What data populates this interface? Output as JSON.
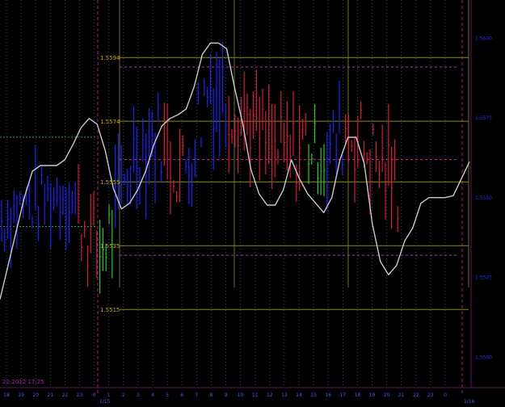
{
  "chart_data": {
    "type": "bar",
    "title": "",
    "timestamp_label": "22-2012 17:25",
    "level_labels": [
      "1.5594",
      "1.5574",
      "1.5555",
      "1.5535",
      "1.5515"
    ],
    "level_values": [
      1.5594,
      1.5574,
      1.5555,
      1.5535,
      1.5515
    ],
    "magenta_levels": [
      1.5591,
      1.5562,
      1.5532
    ],
    "right_axis_labels": [
      "1.5600",
      "1.5575",
      "1.5550",
      "1.5525",
      "1.5500"
    ],
    "right_axis_values": [
      1.56,
      1.5575,
      1.555,
      1.5525,
      1.55
    ],
    "x_tick_labels": [
      "18",
      "19",
      "20",
      "21",
      "22",
      "23",
      "0",
      "1",
      "2",
      "3",
      "4",
      "5",
      "6",
      "7",
      "8",
      "9",
      "10",
      "11",
      "12",
      "13",
      "14",
      "15",
      "16",
      "17",
      "18",
      "19",
      "20",
      "21",
      "22",
      "23",
      "0"
    ],
    "x_day_labels": [
      "1/15",
      "1/16"
    ],
    "ylim": [
      1.5491,
      1.561
    ],
    "oscillator": {
      "color": "#c8c8c8",
      "range": [
        0,
        100
      ],
      "values": [
        4,
        22,
        40,
        58,
        72,
        75,
        75,
        75,
        78,
        86,
        95,
        100,
        97,
        83,
        63,
        52,
        55,
        62,
        72,
        86,
        96,
        100,
        102,
        105,
        117,
        134,
        140,
        140,
        137,
        116,
        97,
        73,
        60,
        54,
        54,
        62,
        78,
        68,
        60,
        55,
        50,
        58,
        78,
        90,
        90,
        76,
        44,
        24,
        17,
        22,
        35,
        42,
        55,
        58,
        58,
        58,
        59,
        68,
        77
      ]
    },
    "bars": {
      "colors": {
        "blue": "#1e1eff",
        "green": "#1ecf1e",
        "red": "#e0143c",
        "magenta": "#c81e78"
      },
      "segments": [
        {
          "from": 0,
          "to": 6,
          "start": 1.5543,
          "end": 1.5547,
          "color": "blue",
          "vol": 3
        },
        {
          "from": 6,
          "to": 13,
          "start": 1.5547,
          "end": 1.5549,
          "color": "blue",
          "vol": 3
        },
        {
          "from": 13,
          "to": 20,
          "start": 1.5549,
          "end": 1.5552,
          "color": "blue",
          "vol": 3
        },
        {
          "from": 20,
          "to": 25,
          "start": 1.5552,
          "end": 1.5547,
          "color": "blue",
          "vol": 3
        },
        {
          "from": 25,
          "to": 32,
          "start": 1.5545,
          "end": 1.5532,
          "color": "red",
          "vol": 4
        },
        {
          "from": 32,
          "to": 37,
          "start": 1.5533,
          "end": 1.5543,
          "color": "green",
          "vol": 4
        },
        {
          "from": 37,
          "to": 44,
          "start": 1.5545,
          "end": 1.5567,
          "color": "blue",
          "vol": 4
        },
        {
          "from": 44,
          "to": 53,
          "start": 1.5565,
          "end": 1.557,
          "color": "blue",
          "vol": 4
        },
        {
          "from": 53,
          "to": 60,
          "start": 1.5565,
          "end": 1.5557,
          "color": "red",
          "vol": 4
        },
        {
          "from": 60,
          "to": 68,
          "start": 1.556,
          "end": 1.5588,
          "color": "blue",
          "vol": 5
        },
        {
          "from": 68,
          "to": 74,
          "start": 1.5588,
          "end": 1.5578,
          "color": "blue",
          "vol": 5
        },
        {
          "from": 74,
          "to": 82,
          "start": 1.558,
          "end": 1.5574,
          "color": "red",
          "vol": 4
        },
        {
          "from": 82,
          "to": 88,
          "start": 1.5572,
          "end": 1.5565,
          "color": "red",
          "vol": 4
        },
        {
          "from": 88,
          "to": 94,
          "start": 1.5565,
          "end": 1.5563,
          "color": "red",
          "vol": 4
        },
        {
          "from": 94,
          "to": 100,
          "start": 1.5563,
          "end": 1.557,
          "color": "red",
          "vol": 4
        },
        {
          "from": 100,
          "to": 106,
          "start": 1.5566,
          "end": 1.5563,
          "color": "green",
          "vol": 3
        },
        {
          "from": 106,
          "to": 112,
          "start": 1.5563,
          "end": 1.5572,
          "color": "blue",
          "vol": 4
        },
        {
          "from": 112,
          "to": 118,
          "start": 1.5572,
          "end": 1.5567,
          "color": "red",
          "vol": 4
        },
        {
          "from": 118,
          "to": 124,
          "start": 1.5566,
          "end": 1.556,
          "color": "red",
          "vol": 4
        },
        {
          "from": 124,
          "to": 130,
          "start": 1.556,
          "end": 1.5552,
          "color": "red",
          "vol": 4
        }
      ]
    },
    "dashed_levels_left": [
      1.5569,
      1.5541
    ]
  }
}
